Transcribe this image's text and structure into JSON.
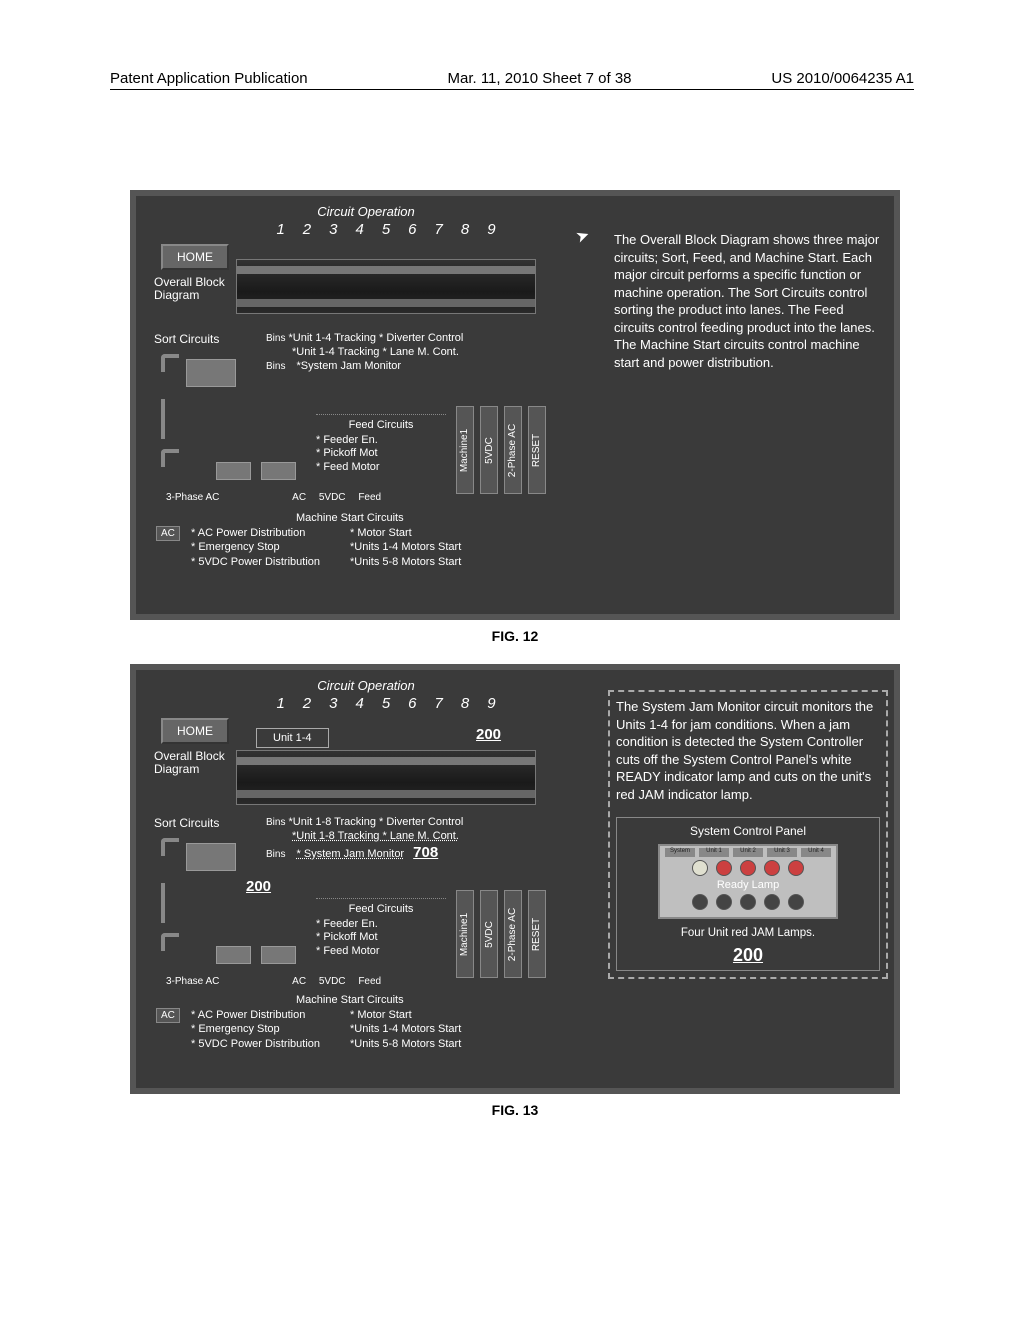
{
  "header": {
    "left": "Patent Application Publication",
    "mid": "Mar. 11, 2010  Sheet 7 of 38",
    "right": "US 2010/0064235 A1"
  },
  "fig12": {
    "caption": "FIG. 12",
    "title": "Circuit Operation",
    "nums": [
      "1",
      "2",
      "3",
      "4",
      "5",
      "6",
      "7",
      "8",
      "9"
    ],
    "home": "HOME",
    "overall": "Overall Block\nDiagram",
    "sort_label": "Sort Circuits",
    "bins": "Bins",
    "sort_items": [
      "*Unit 1-4 Tracking   * Diverter Control",
      "*Unit 1-4 Tracking    * Lane M. Cont.",
      "*System Jam Monitor"
    ],
    "feed_head": "Feed Circuits",
    "feed_items": [
      "* Feeder En.",
      "* Pickoff Mot",
      "* Feed Motor"
    ],
    "vbars": [
      "Machine1",
      "5VDC",
      "2-Phase AC",
      "RESET"
    ],
    "btm": {
      "a": "3-Phase AC",
      "b": "AC",
      "c": "5VDC",
      "d": "Feed"
    },
    "mstart_label": "Machine Start Circuits",
    "ac": "AC",
    "mstart_left": [
      "* AC Power Distribution",
      "* Emergency Stop",
      "* 5VDC Power Distribution"
    ],
    "mstart_right": [
      "* Motor Start",
      "*Units 1-4 Motors Start",
      "*Units 5-8 Motors Start"
    ],
    "descr": "The Overall Block Diagram shows three major circuits; Sort, Feed, and Machine Start. Each major circuit performs a specific function or machine operation. The Sort Circuits control sorting the product into lanes. The Feed circuits control feeding product into the lanes. The Machine Start circuits control machine start and power distribution."
  },
  "fig13": {
    "caption": "FIG. 13",
    "title": "Circuit Operation",
    "nums": [
      "1",
      "2",
      "3",
      "4",
      "5",
      "6",
      "7",
      "8",
      "9"
    ],
    "home": "HOME",
    "overall": "Overall Block\nDiagram",
    "unit_label": "Unit 1-4",
    "call_200_a": "200",
    "call_200_b": "200",
    "call_708": "708",
    "sort_label": "Sort Circuits",
    "bins": "Bins",
    "sort_items": [
      "*Unit 1-8 Tracking   * Diverter Control",
      "*Unit 1-8 Tracking    * Lane M. Cont.",
      "* System Jam Monitor"
    ],
    "feed_head": "Feed Circuits",
    "feed_items": [
      "* Feeder En.",
      "* Pickoff Mot",
      "* Feed Motor"
    ],
    "vbars": [
      "Machine1",
      "5VDC",
      "2-Phase AC",
      "RESET"
    ],
    "btm": {
      "a": "3-Phase AC",
      "b": "AC",
      "c": "5VDC",
      "d": "Feed"
    },
    "mstart_label": "Machine Start Circuits",
    "ac": "AC",
    "mstart_left": [
      "* AC Power Distribution",
      "* Emergency Stop",
      "* 5VDC Power Distribution"
    ],
    "mstart_right": [
      "* Motor Start",
      "*Units 1-4 Motors Start",
      "*Units 5-8 Motors Start"
    ],
    "descr": "The System Jam Monitor circuit monitors the Units 1-4 for jam conditions. When a jam condition is detected the System Controller cuts off the System Control Panel's white READY indicator lamp and cuts on the unit's red JAM indicator lamp.",
    "scp_title": "System Control Panel",
    "scp_row": [
      "System",
      "Unit 1",
      "Unit 2",
      "Unit 3",
      "Unit 4"
    ],
    "scp_ready": "Ready Lamp",
    "scp_sub": "Four Unit red JAM Lamps.",
    "scp_200": "200"
  }
}
